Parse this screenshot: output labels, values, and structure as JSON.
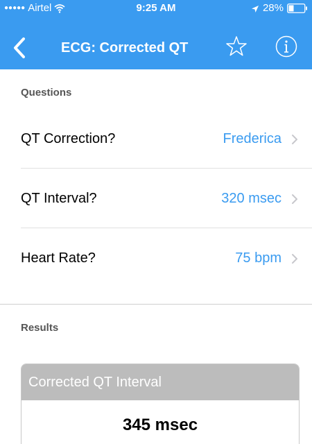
{
  "status_bar": {
    "signal": "●●●●●",
    "carrier": "Airtel",
    "time": "9:25 AM",
    "battery_percent": "28%",
    "icons": [
      "wifi-icon",
      "location-arrow-icon",
      "battery-icon"
    ]
  },
  "nav": {
    "title": "ECG: Corrected QT",
    "back_icon": "chevron-left-icon",
    "favorite_icon": "star-outline-icon",
    "info_icon": "info-circle-icon"
  },
  "questions": {
    "header": "Questions",
    "items": [
      {
        "label": "QT Correction?",
        "value": "Frederica"
      },
      {
        "label": "QT Interval?",
        "value": "320 msec"
      },
      {
        "label": "Heart Rate?",
        "value": "75 bpm"
      }
    ]
  },
  "results": {
    "header": "Results",
    "card_title": "Corrected QT Interval",
    "card_value": "345 msec"
  },
  "colors": {
    "accent": "#3a9bf0",
    "card_header": "#bcbcbc",
    "divider": "#e0e0e0"
  }
}
